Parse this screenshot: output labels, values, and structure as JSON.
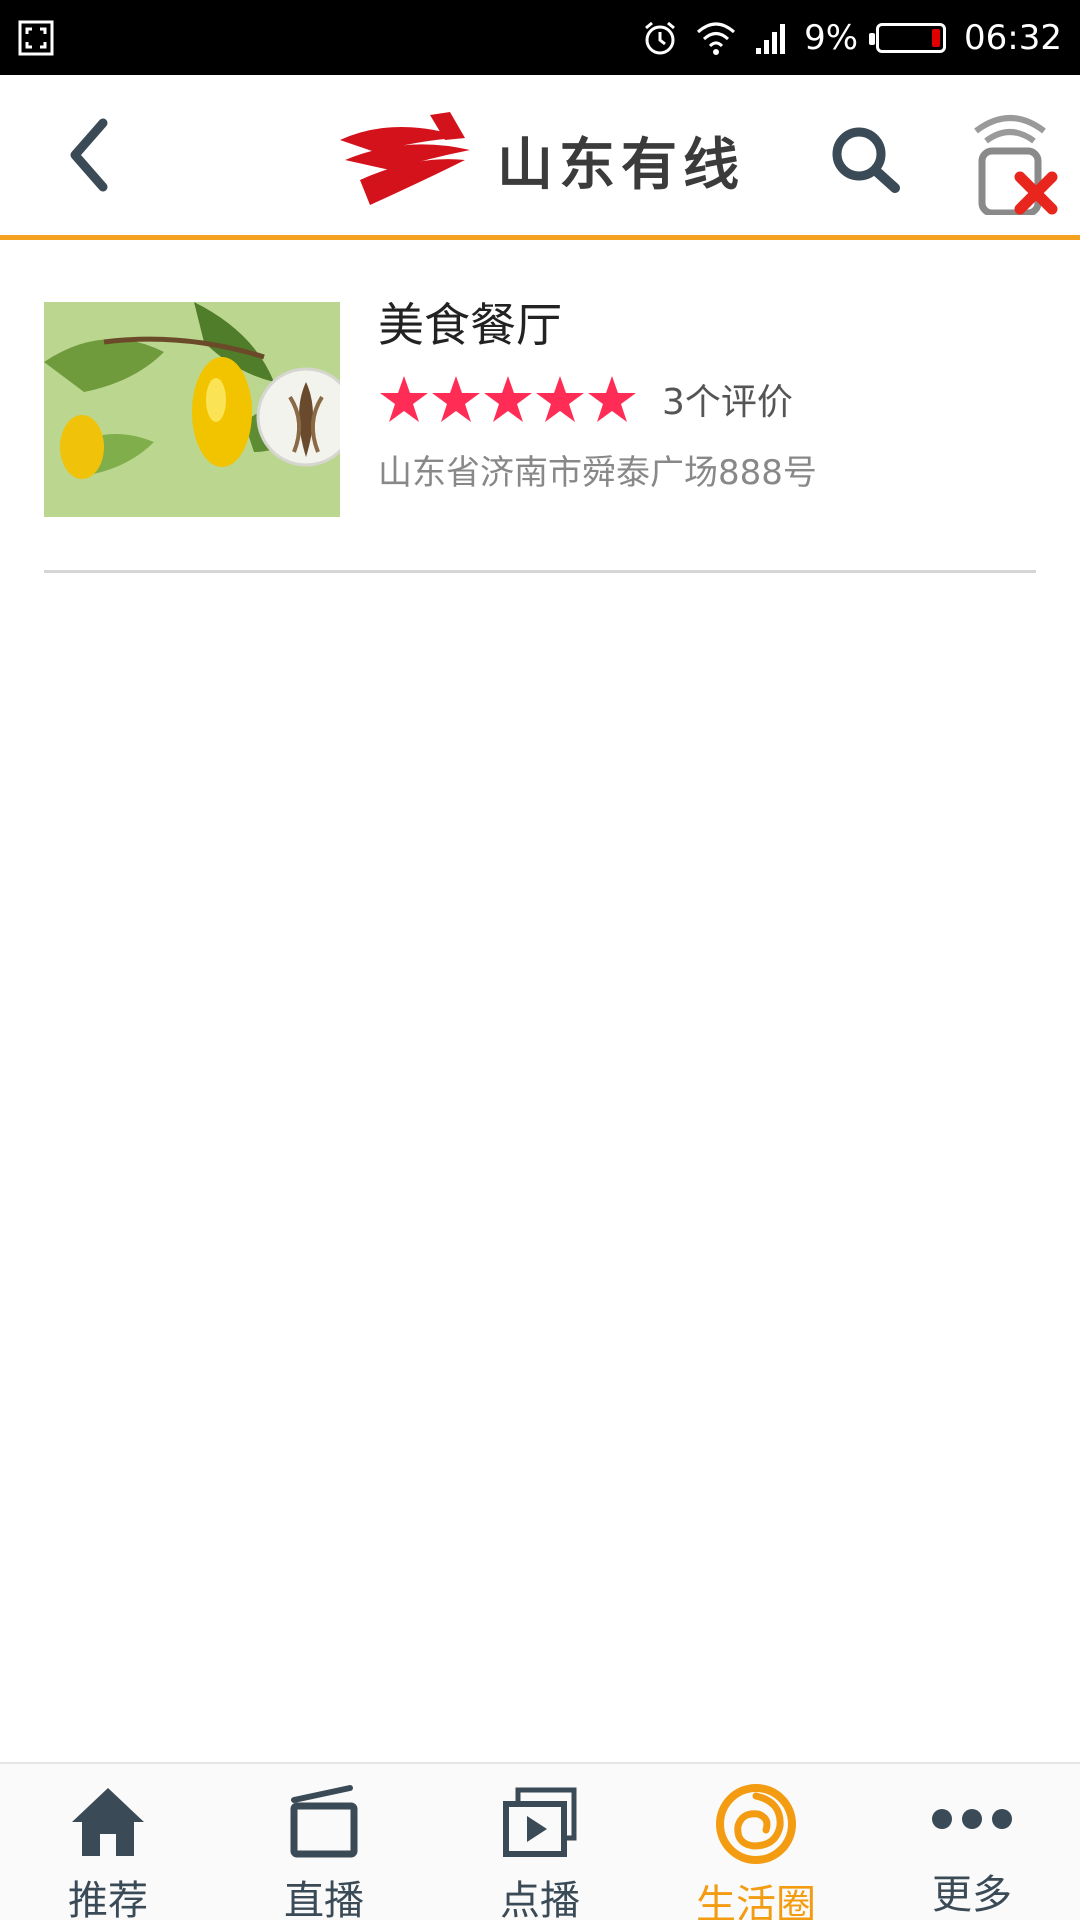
{
  "status_bar": {
    "battery_percent": "9%",
    "time": "06:32",
    "battery_level": 0.09
  },
  "header": {
    "logo_text": "山东有线",
    "brand_color": "#d4121b",
    "accent_color": "#f4a21f"
  },
  "listing": {
    "title": "美食餐厅",
    "rating_stars": 5,
    "reviews_label": "3个评价",
    "address": "山东省济南市舜泰广场888号",
    "star_color": "#ff2d55"
  },
  "bottom_nav": {
    "items": [
      {
        "label": "推荐",
        "icon": "home-icon",
        "active": false
      },
      {
        "label": "直播",
        "icon": "tv-icon",
        "active": false
      },
      {
        "label": "点播",
        "icon": "play-icon",
        "active": false
      },
      {
        "label": "生活圈",
        "icon": "circle-life-icon",
        "active": true
      },
      {
        "label": "更多",
        "icon": "more-icon",
        "active": false
      }
    ],
    "active_color": "#f39c12",
    "inactive_color": "#3a4a56"
  }
}
